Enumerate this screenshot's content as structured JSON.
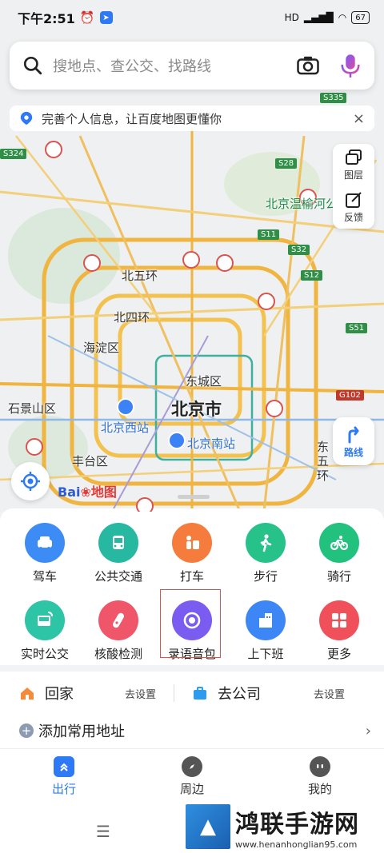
{
  "status_bar": {
    "time": "下午2:51",
    "battery": "67",
    "network": "HD"
  },
  "search": {
    "placeholder": "搜地点、查公交、找路线"
  },
  "notice": {
    "text": "完善个人信息，让百度地图更懂你",
    "close": "×"
  },
  "map_tools": {
    "layers": "图层",
    "feedback": "反馈",
    "route": "路线"
  },
  "map_labels": {
    "city": "北京市",
    "ring5": "北五环",
    "ring4": "北四环",
    "haidian": "海淀区",
    "dongcheng": "东城区",
    "shijingshan": "石景山区",
    "fengtai": "丰台区",
    "west_station": "北京西站",
    "south_station": "北京南站",
    "east_ring": "东五环",
    "wenyu": "北京温榆河公",
    "roads": [
      "S335",
      "S28",
      "S11",
      "S32",
      "S12",
      "S51",
      "G102",
      "S324"
    ]
  },
  "baidu_logo": {
    "text": "Bai",
    "map": "地图"
  },
  "features": [
    {
      "label": "驾车",
      "icon": "car-icon",
      "color": "#3d8bf5"
    },
    {
      "label": "公共交通",
      "icon": "bus-icon",
      "color": "#26b8a0"
    },
    {
      "label": "打车",
      "icon": "taxi-icon",
      "color": "#f57c3d"
    },
    {
      "label": "步行",
      "icon": "walk-icon",
      "color": "#26c28a"
    },
    {
      "label": "骑行",
      "icon": "bike-icon",
      "color": "#22c27e"
    },
    {
      "label": "实时公交",
      "icon": "realtime-bus-icon",
      "color": "#2ec4a6"
    },
    {
      "label": "核酸检测",
      "icon": "test-tube-icon",
      "color": "#f0566a"
    },
    {
      "label": "录语音包",
      "icon": "record-icon",
      "color": "#7a5cf0"
    },
    {
      "label": "上下班",
      "icon": "building-icon",
      "color": "#3d86f5"
    },
    {
      "label": "更多",
      "icon": "grid-icon",
      "color": "#f0505a"
    }
  ],
  "addresses": {
    "home": "回家",
    "home_set": "去设置",
    "work": "去公司",
    "work_set": "去设置",
    "add": "添加常用地址"
  },
  "tabs": [
    {
      "label": "出行",
      "active": true
    },
    {
      "label": "周边",
      "active": false
    },
    {
      "label": "我的",
      "active": false
    }
  ],
  "watermark": {
    "title": "鸿联手游网",
    "url": "www.henanhonglian95.com"
  }
}
